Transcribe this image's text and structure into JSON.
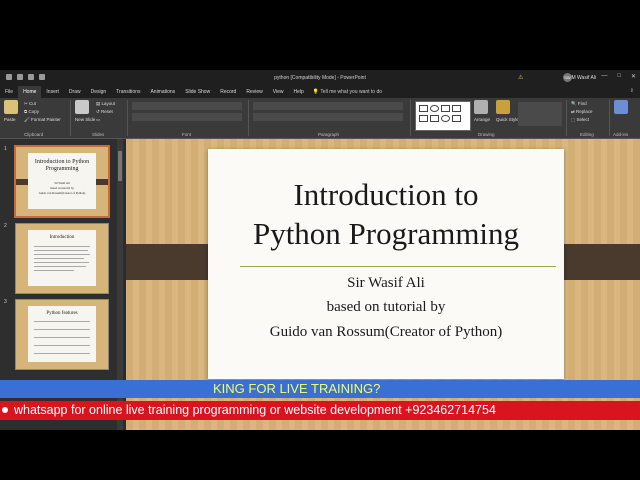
{
  "window": {
    "doc_title": "python [Compatibility Mode] - PowerPoint",
    "user_name": "S.M Wasif Ali",
    "user_initials": "SW",
    "warning_icon": "warning-icon"
  },
  "tabs": [
    "File",
    "Home",
    "Insert",
    "Draw",
    "Design",
    "Transitions",
    "Animations",
    "Slide Show",
    "Record",
    "Review",
    "View",
    "Help"
  ],
  "tell_me": "Tell me what you want to do",
  "ribbon": {
    "paste": "Paste",
    "cut": "Cut",
    "copy": "Copy",
    "format_painter": "Format Painter",
    "clipboard": "Clipboard",
    "new_slide": "New Slide",
    "layout": "Layout",
    "reset": "Reset",
    "slides": "Slides",
    "font": "Font",
    "paragraph": "Paragraph",
    "arrange": "Arrange",
    "quick_styles": "Quick Styles",
    "drawing": "Drawing",
    "find": "Find",
    "replace": "Replace",
    "select": "Select",
    "editing": "Editing",
    "addins": "Add-ins"
  },
  "thumbnails": [
    {
      "num": "1",
      "title": "Introduction to Python Programming",
      "sub1": "Sir Wasif Ali",
      "sub2": "based on tutorial by",
      "sub3": "Guido van Rossum(Creator of Python)"
    },
    {
      "num": "2",
      "title": "Introduction"
    },
    {
      "num": "3",
      "title": "Python features"
    }
  ],
  "slide": {
    "title_line1": "Introduction to",
    "title_line2": "Python Programming",
    "presenter": "Sir Wasif  Ali",
    "based_on": "based on tutorial by",
    "creator": "Guido van Rossum(Creator of Python)"
  },
  "overlay": {
    "banner_top": "KING FOR LIVE TRAINING?",
    "banner_bottom": "whatsapp for online live training programming or website development +923462714754"
  },
  "colors": {
    "accent_tab": "#c76b3c",
    "wood": "#d7b47a",
    "band": "#4a3a2e",
    "banner_blue": "#3a6fd6",
    "banner_red": "#d9141f",
    "banner_text_yellow": "#f4ff5a"
  }
}
